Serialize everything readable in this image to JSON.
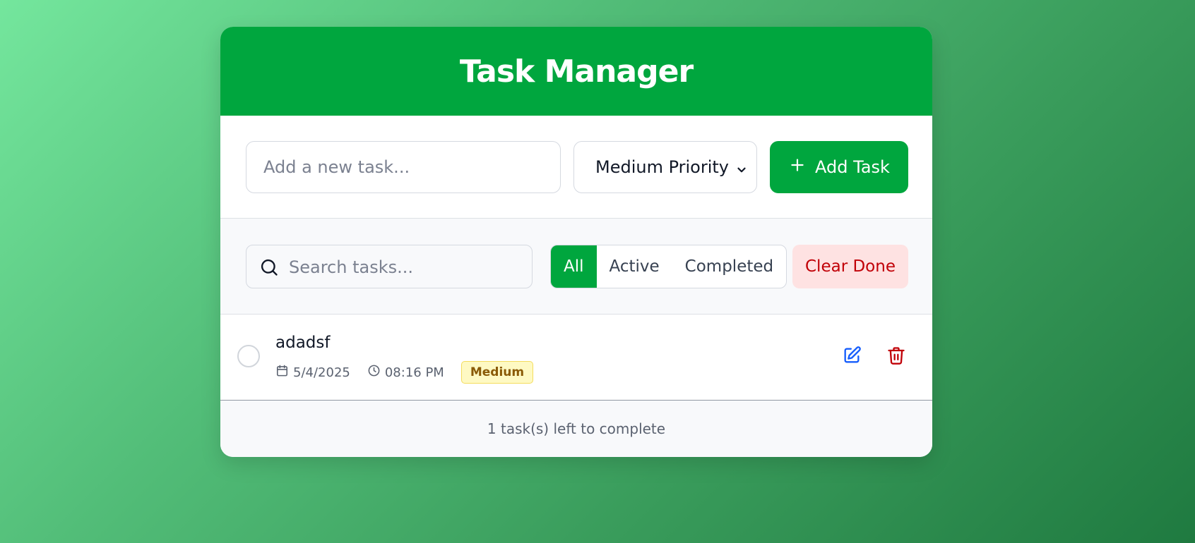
{
  "header": {
    "title": "Task Manager"
  },
  "add_form": {
    "input_placeholder": "Add a new task...",
    "input_value": "",
    "priority_selected": "Medium Priority",
    "add_button_label": "Add Task"
  },
  "filters": {
    "search_placeholder": "Search tasks...",
    "search_value": "",
    "tabs": [
      {
        "label": "All",
        "active": true
      },
      {
        "label": "Active",
        "active": false
      },
      {
        "label": "Completed",
        "active": false
      }
    ],
    "clear_done_label": "Clear Done"
  },
  "tasks": [
    {
      "title": "adadsf",
      "date": "5/4/2025",
      "time": "08:16 PM",
      "priority": "Medium",
      "completed": false
    }
  ],
  "footer": {
    "status": "1 task(s) left to complete"
  },
  "colors": {
    "primary": "#00a63e",
    "danger": "#c10007",
    "danger_bg": "#fee2e2",
    "edit": "#155dfc",
    "badge_bg": "#fef9c3",
    "badge_text": "#8a5a06"
  },
  "icons": {
    "add": "plus-icon",
    "select": "chevron-down-icon",
    "search": "search-icon",
    "date": "calendar-icon",
    "time": "clock-icon",
    "edit": "edit-icon",
    "delete": "trash-icon"
  }
}
